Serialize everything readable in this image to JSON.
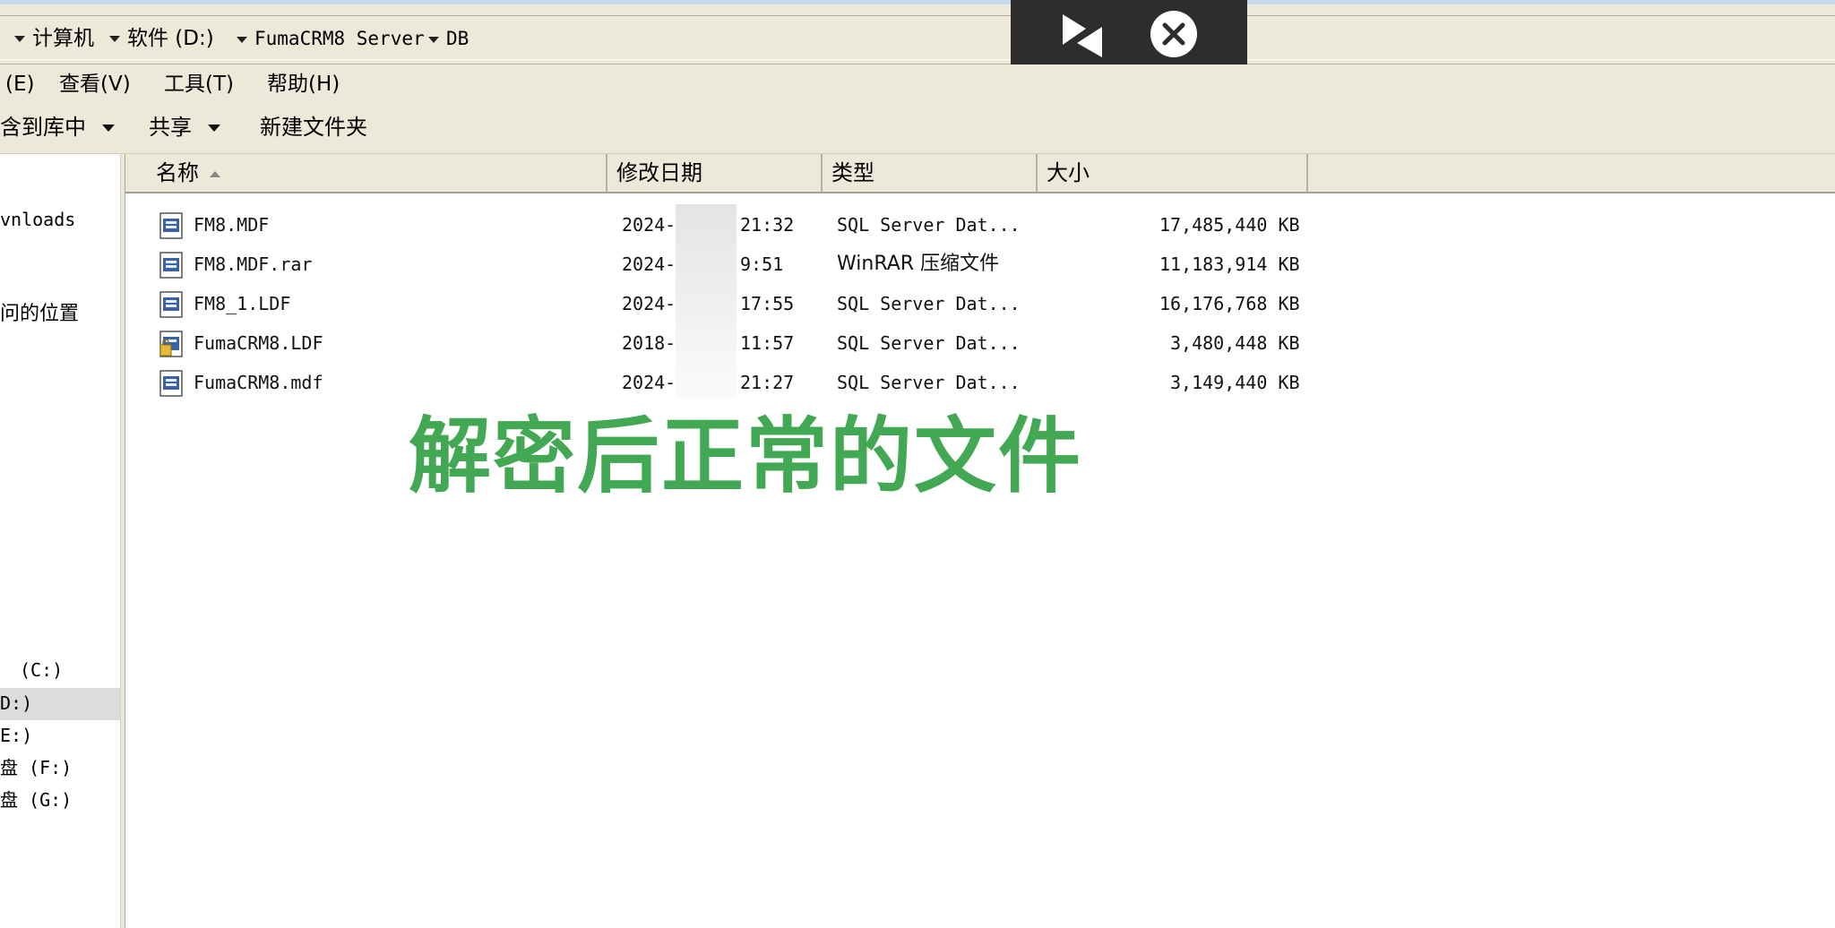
{
  "address": {
    "crumbs": [
      {
        "label": "计算机"
      },
      {
        "label": "软件 (D:)"
      },
      {
        "label": "FumaCRM8 Server"
      },
      {
        "label": "DB"
      }
    ]
  },
  "menu": {
    "edit": "(E)",
    "view": "查看(V)",
    "tools": "工具(T)",
    "help": "帮助(H)"
  },
  "toolbar": {
    "include_library": "含到库中",
    "share": "共享",
    "new_folder": "新建文件夹"
  },
  "sidebar": {
    "downloads": "vnloads",
    "recent_places": "问的位置",
    "drive_c": "(C:)",
    "drive_d": "D:)",
    "drive_e": "E:)",
    "drive_f": "盘  (F:)",
    "drive_g": "盘 (G:)"
  },
  "columns": {
    "name": "名称",
    "modified": "修改日期",
    "type": "类型",
    "size": "大小"
  },
  "files": [
    {
      "name": "FM8.MDF",
      "date": "2024-",
      "time": "21:32",
      "type": "SQL Server Dat...",
      "size": "17,485,440 KB",
      "icon": "database-file-icon"
    },
    {
      "name": "FM8.MDF.rar",
      "date": "2024-",
      "time": "9:51",
      "type": "WinRAR 压缩文件",
      "size": "11,183,914 KB",
      "icon": "rar-archive-icon"
    },
    {
      "name": "FM8_1.LDF",
      "date": "2024-",
      "time": "17:55",
      "type": "SQL Server Dat...",
      "size": "16,176,768 KB",
      "icon": "database-file-icon"
    },
    {
      "name": "FumaCRM8.LDF",
      "date": "2018-",
      "time": "11:57",
      "type": "SQL Server Dat...",
      "size": "3,480,448 KB",
      "icon": "locked-database-file-icon"
    },
    {
      "name": "FumaCRM8.mdf",
      "date": "2024-",
      "time": "21:27",
      "type": "SQL Server Dat...",
      "size": "3,149,440 KB",
      "icon": "database-file-icon"
    }
  ],
  "overlay": {
    "caption": "解密后正常的文件"
  },
  "player": {
    "icons": [
      "skip-back-icon",
      "close-circle-icon"
    ]
  },
  "colors": {
    "caption_green": "#43a853",
    "chrome_beige": "#ece9d8",
    "player_dark": "#2d2d2d"
  }
}
